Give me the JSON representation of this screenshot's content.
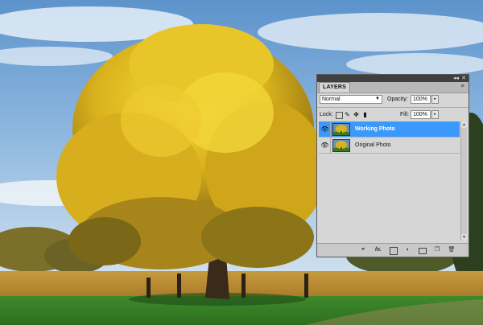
{
  "panel": {
    "tab_label": "LAYERS",
    "collapse_glyph": "◂◂",
    "close_glyph": "✕",
    "menu_glyph": "≡",
    "blend_mode": "Normal",
    "opacity_label": "Opacity:",
    "opacity_value": "100%",
    "lock_label": "Lock:",
    "fill_label": "Fill:",
    "fill_value": "100%",
    "layers": [
      {
        "name": "Working Photo",
        "selected": true,
        "visible": true
      },
      {
        "name": "Original Photo",
        "selected": false,
        "visible": true
      }
    ],
    "bottom_icons": [
      "link-icon",
      "fx-icon",
      "mask-icon",
      "adjustment-icon",
      "group-icon",
      "new-layer-icon",
      "trash-icon"
    ],
    "fx_label": "fx.",
    "colors": {
      "selected_row": "#3b99fc",
      "panel_bg": "#d6d6d6"
    }
  }
}
